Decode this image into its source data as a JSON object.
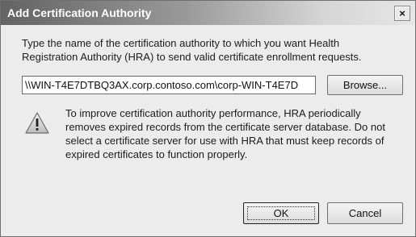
{
  "window": {
    "title": "Add Certification Authority",
    "close_label": "×"
  },
  "intro": {
    "line1": "Type the name of the certification authority to which you want Health",
    "line2": "Registration Authority (HRA) to send valid certificate enrollment requests."
  },
  "ca_field": {
    "value": "\\\\WIN-T4E7DTBQ3AX.corp.contoso.com\\corp-WIN-T4E7D"
  },
  "buttons": {
    "browse": "Browse...",
    "ok": "OK",
    "cancel": "Cancel"
  },
  "warning": {
    "icon": "warning-icon",
    "line1": "To improve certification authority performance, HRA periodically",
    "line2": "removes expired records from the certificate server database. Do not",
    "line3": "select a certificate server for use with HRA that must keep records of",
    "line4": "expired certificates to function properly."
  }
}
